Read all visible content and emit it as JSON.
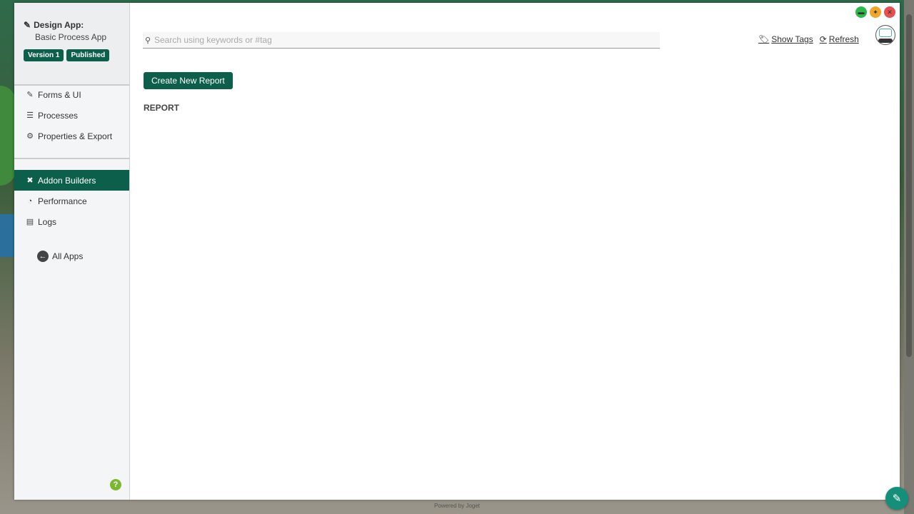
{
  "sidebar": {
    "app_title": "Design App:",
    "app_name": "Basic Process App",
    "badges": [
      "Version 1",
      "Published"
    ],
    "nav_primary": [
      {
        "label": "Forms & UI",
        "icon": "edit-icon"
      },
      {
        "label": "Processes",
        "icon": "list-icon"
      },
      {
        "label": "Properties & Export",
        "icon": "gear-icon"
      }
    ],
    "nav_secondary": [
      {
        "label": "Addon Builders",
        "icon": "tools-icon",
        "active": true
      },
      {
        "label": "Performance",
        "icon": "dashboard-icon"
      },
      {
        "label": "Logs",
        "icon": "scroll-icon"
      }
    ],
    "all_apps_label": "All Apps",
    "help_label": "?"
  },
  "search": {
    "placeholder": "Search using keywords or #tag"
  },
  "header_links": {
    "show_tags": "Show Tags",
    "refresh": "Refresh"
  },
  "main": {
    "create_button": "Create New Report",
    "section_title": "REPORT"
  },
  "footer": {
    "powered_by": "Powered by Joget"
  },
  "colors": {
    "accent": "#0c5f4a",
    "window_min": "#2db84a",
    "window_pin": "#f0a52b",
    "window_close": "#e55050",
    "fab": "#14907a"
  }
}
